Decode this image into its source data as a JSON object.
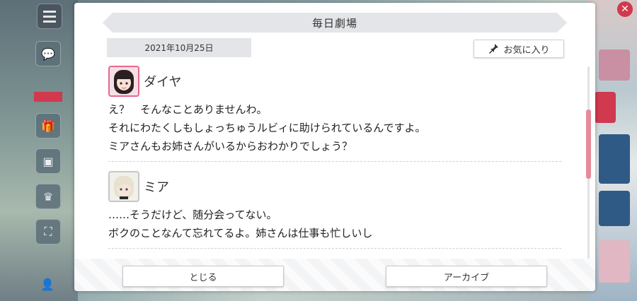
{
  "dialog": {
    "title": "毎日劇場",
    "date": "2021年10月25日",
    "favorite_label": "お気に入り",
    "entries": [
      {
        "speaker": "ダイヤ",
        "lines": [
          "え？　そんなことありませんわ。",
          "それにわたくしもしょっちゅうルビィに助けられているんですよ。",
          "ミアさんもお姉さんがいるからおわかりでしょう？"
        ]
      },
      {
        "speaker": "ミア",
        "lines": [
          "……そうだけど、随分会ってない。",
          "ボクのことなんて忘れてるよ。姉さんは仕事も忙しいし"
        ]
      }
    ],
    "close_label": "とじる",
    "archive_label": "アーカイブ",
    "scroll_position": 0.35
  },
  "colors": {
    "accent": "#e78a9a",
    "dia_frame": "#e46a8c",
    "panel_gray": "#e4e5e8"
  },
  "icons": [
    "menu-icon",
    "pin-icon",
    "close-icon"
  ]
}
